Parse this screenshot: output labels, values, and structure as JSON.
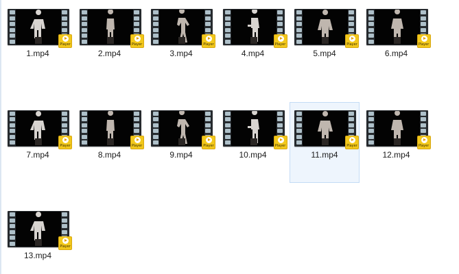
{
  "files": [
    {
      "name": "1.mp4",
      "badge": "Player",
      "selected": false
    },
    {
      "name": "2.mp4",
      "badge": "Player",
      "selected": false
    },
    {
      "name": "3.mp4",
      "badge": "Player",
      "selected": false
    },
    {
      "name": "4.mp4",
      "badge": "Player",
      "selected": false
    },
    {
      "name": "5.mp4",
      "badge": "Player",
      "selected": false
    },
    {
      "name": "6.mp4",
      "badge": "Player",
      "selected": false
    },
    {
      "name": "7.mp4",
      "badge": "Player",
      "selected": false
    },
    {
      "name": "8.mp4",
      "badge": "Player",
      "selected": false
    },
    {
      "name": "9.mp4",
      "badge": "Player",
      "selected": false
    },
    {
      "name": "10.mp4",
      "badge": "Player",
      "selected": false
    },
    {
      "name": "11.mp4",
      "badge": "Player",
      "selected": true
    },
    {
      "name": "12.mp4",
      "badge": "Player",
      "selected": false
    },
    {
      "name": "13.mp4",
      "badge": "Player",
      "selected": false
    }
  ],
  "colors": {
    "selection_fill": "#eef5fd",
    "selection_border": "#c3dbf5",
    "badge": "#f2c81b",
    "film_strip": "#262a2e"
  },
  "icons": {
    "thumbnail": "video-film-strip-icon",
    "badge": "player-badge-icon"
  }
}
